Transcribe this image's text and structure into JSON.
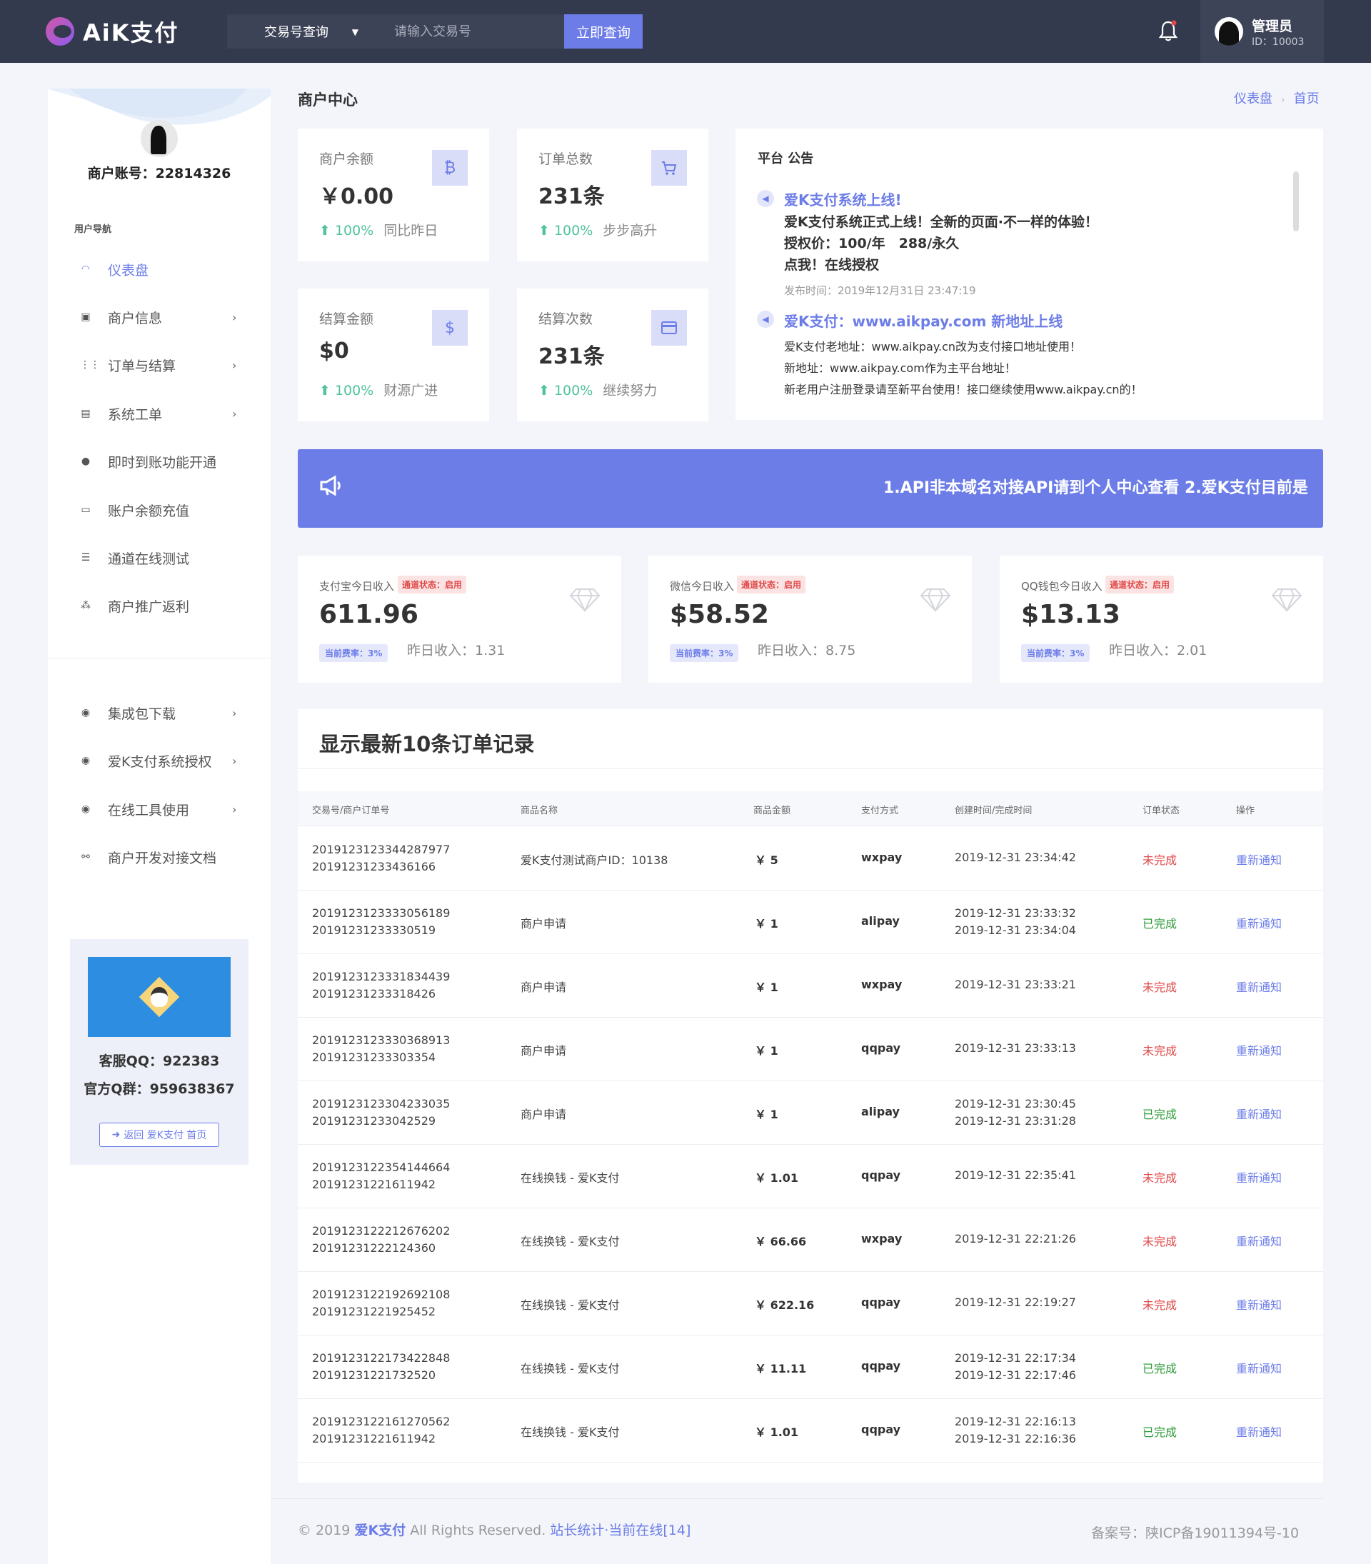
{
  "header": {
    "logo_text": "AiK支付",
    "search_type": "交易号查询",
    "search_placeholder": "请输入交易号",
    "search_button": "立即查询",
    "user_name": "管理员",
    "user_id": "ID：10003"
  },
  "sidebar": {
    "account": "商户账号：22814326",
    "nav_heading": "用户导航",
    "items": [
      {
        "label": "仪表盘",
        "icon": "gauge-icon"
      },
      {
        "label": "商户信息",
        "icon": "id-card-icon"
      },
      {
        "label": "订单与结算",
        "icon": "grid-icon"
      },
      {
        "label": "系统工单",
        "icon": "ticket-icon"
      },
      {
        "label": "即时到账功能开通",
        "icon": "check-circle-icon"
      },
      {
        "label": "账户余额充值",
        "icon": "wallet-icon"
      },
      {
        "label": "通道在线测试",
        "icon": "list-icon"
      },
      {
        "label": "商户推广返利",
        "icon": "users-icon"
      },
      {
        "label": "集成包下载",
        "icon": "circle-dot-icon"
      },
      {
        "label": "爱K支付系统授权",
        "icon": "circle-dot-icon"
      },
      {
        "label": "在线工具使用",
        "icon": "circle-dot-icon"
      },
      {
        "label": "商户开发对接文档",
        "icon": "link-icon"
      }
    ],
    "support_qq": "客服QQ：922383",
    "support_group": "官方Q群：959638367",
    "back_home": "返回 爱K支付 首页"
  },
  "page": {
    "title": "商户中心",
    "breadcrumb": [
      "仪表盘",
      "首页"
    ]
  },
  "stats": [
    {
      "label": "商户余额",
      "value": "￥0.00",
      "pct": "100%",
      "note": "同比昨日",
      "icon": "bitcoin-icon",
      "glyph": "₿"
    },
    {
      "label": "订单总数",
      "value": "231条",
      "pct": "100%",
      "note": "步步高升",
      "icon": "cart-icon",
      "glyph": "🛒"
    },
    {
      "label": "结算金额",
      "value": "$0",
      "pct": "100%",
      "note": "财源广进",
      "icon": "dollar-icon",
      "glyph": "$"
    },
    {
      "label": "结算次数",
      "value": "231条",
      "pct": "100%",
      "note": "继续努力",
      "icon": "card-icon",
      "glyph": "▭"
    }
  ],
  "notice": {
    "title": "平台 公告",
    "n1_headline": "爱K支付系统上线!",
    "n1_line1": "爱K支付系统正式上线！全新的页面·不一样的体验！",
    "n1_line2": "授权价：100/年　288/永久",
    "n1_line3": "点我！在线授权",
    "n1_time": "发布时间：2019年12月31日 23:47:19",
    "n2_headline": "爱K支付：www.aikpay.com 新地址上线",
    "n2_line1": "爱K支付老地址：www.aikpay.cn改为支付接口地址使用！",
    "n2_line2": "新地址：www.aikpay.com作为主平台地址！",
    "n2_line3": "新老用户注册登录请至新平台使用！接口继续使用www.aikpay.cn的！"
  },
  "marquee": "1.API非本域名对接API请到个人中心查看 2.爱K支付目前是",
  "income": [
    {
      "label": "支付宝今日收入",
      "status": "通道状态：启用",
      "value": "611.96",
      "rate": "当前费率：3%",
      "yesterday": "昨日收入：1.31"
    },
    {
      "label": "微信今日收入",
      "status": "通道状态：启用",
      "value": "$58.52",
      "rate": "当前费率：3%",
      "yesterday": "昨日收入：8.75"
    },
    {
      "label": "QQ钱包今日收入",
      "status": "通道状态：启用",
      "value": "$13.13",
      "rate": "当前费率：3%",
      "yesterday": "昨日收入：2.01"
    }
  ],
  "orders": {
    "title": "显示最新10条订单记录",
    "headers": [
      "交易号/商户订单号",
      "商品名称",
      "商品金额",
      "支付方式",
      "创建时间/完成时间",
      "订单状态",
      "操作"
    ],
    "rows": [
      {
        "trade": "2019123123344287977",
        "order": "20191231233436166",
        "name": "爱K支付测试商户ID：10138",
        "amount": "￥ 5",
        "method": "wxpay",
        "created": "2019-12-31 23:34:42",
        "finished": "",
        "status": "未完成",
        "done": false,
        "action": "重新通知"
      },
      {
        "trade": "2019123123333056189",
        "order": "20191231233330519",
        "name": "商户申请",
        "amount": "￥ 1",
        "method": "alipay",
        "created": "2019-12-31 23:33:32",
        "finished": "2019-12-31 23:34:04",
        "status": "已完成",
        "done": true,
        "action": "重新通知"
      },
      {
        "trade": "2019123123331834439",
        "order": "20191231233318426",
        "name": "商户申请",
        "amount": "￥ 1",
        "method": "wxpay",
        "created": "2019-12-31 23:33:21",
        "finished": "",
        "status": "未完成",
        "done": false,
        "action": "重新通知"
      },
      {
        "trade": "2019123123330368913",
        "order": "20191231233303354",
        "name": "商户申请",
        "amount": "￥ 1",
        "method": "qqpay",
        "created": "2019-12-31 23:33:13",
        "finished": "",
        "status": "未完成",
        "done": false,
        "action": "重新通知"
      },
      {
        "trade": "2019123123304233035",
        "order": "20191231233042529",
        "name": "商户申请",
        "amount": "￥ 1",
        "method": "alipay",
        "created": "2019-12-31 23:30:45",
        "finished": "2019-12-31 23:31:28",
        "status": "已完成",
        "done": true,
        "action": "重新通知"
      },
      {
        "trade": "2019123122354144664",
        "order": "20191231221611942",
        "name": "在线换钱 - 爱K支付",
        "amount": "￥ 1.01",
        "method": "qqpay",
        "created": "2019-12-31 22:35:41",
        "finished": "",
        "status": "未完成",
        "done": false,
        "action": "重新通知"
      },
      {
        "trade": "2019123122212676202",
        "order": "20191231222124360",
        "name": "在线换钱 - 爱K支付",
        "amount": "￥ 66.66",
        "method": "wxpay",
        "created": "2019-12-31 22:21:26",
        "finished": "",
        "status": "未完成",
        "done": false,
        "action": "重新通知"
      },
      {
        "trade": "2019123122192692108",
        "order": "20191231221925452",
        "name": "在线换钱 - 爱K支付",
        "amount": "￥ 622.16",
        "method": "qqpay",
        "created": "2019-12-31 22:19:27",
        "finished": "",
        "status": "未完成",
        "done": false,
        "action": "重新通知"
      },
      {
        "trade": "2019123122173422848",
        "order": "20191231221732520",
        "name": "在线换钱 - 爱K支付",
        "amount": "￥ 11.11",
        "method": "qqpay",
        "created": "2019-12-31 22:17:34",
        "finished": "2019-12-31 22:17:46",
        "status": "已完成",
        "done": true,
        "action": "重新通知"
      },
      {
        "trade": "2019123122161270562",
        "order": "20191231221611942",
        "name": "在线换钱 - 爱K支付",
        "amount": "￥ 1.01",
        "method": "qqpay",
        "created": "2019-12-31 22:16:13",
        "finished": "2019-12-31 22:16:36",
        "status": "已完成",
        "done": true,
        "action": "重新通知"
      }
    ]
  },
  "footer": {
    "copyright": "© 2019",
    "brand": "爱K支付",
    "rights": "All Rights Reserved.",
    "stats": "站长统计·当前在线[14]",
    "icp": "备案号：陕ICP备19011394号-10"
  },
  "colors": {
    "accent": "#6c7de8",
    "header_bg": "#343a4d",
    "success": "#4fc39a",
    "danger": "#e04848"
  }
}
